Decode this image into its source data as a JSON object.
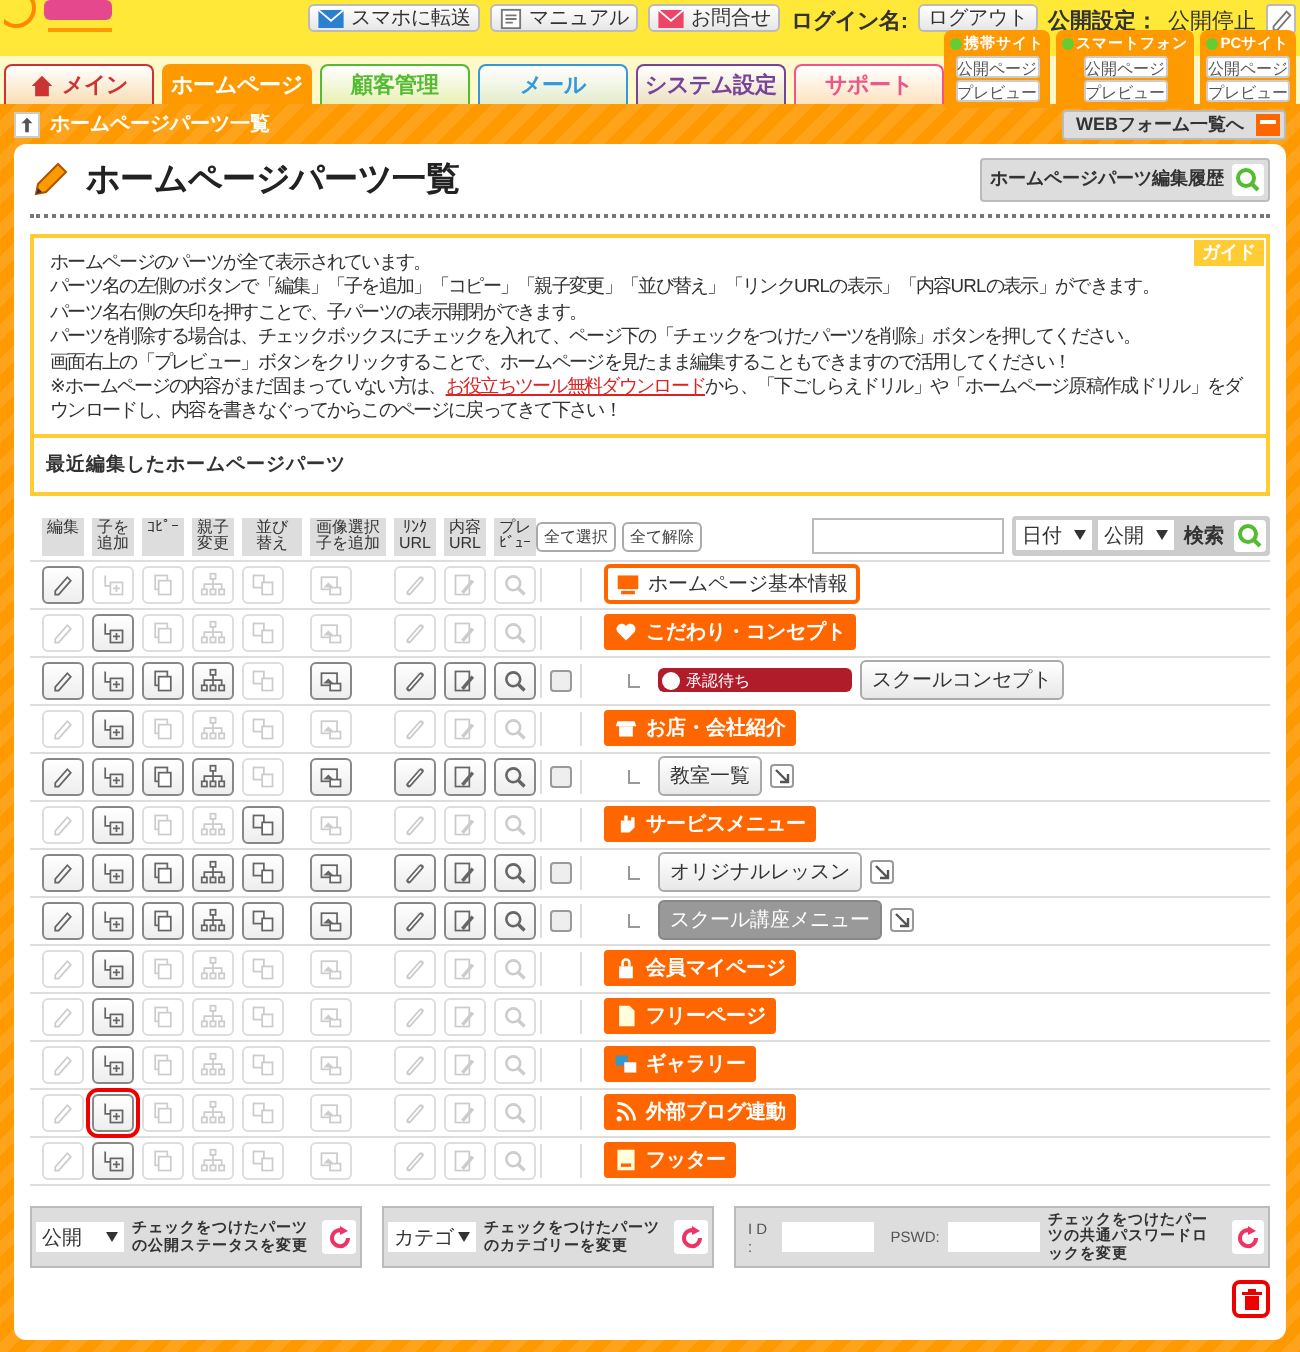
{
  "header": {
    "top_buttons": [
      "スマホに転送",
      "マニュアル",
      "お問合せ"
    ],
    "login_label": "ログイン名:",
    "logout": "ログアウト",
    "publish_label": "公開設定：",
    "publish_value": "公開停止"
  },
  "sites": [
    {
      "title": "携帯サイト",
      "buttons": [
        "公開ページ",
        "プレビュー"
      ]
    },
    {
      "title": "スマートフォン",
      "buttons": [
        "公開ページ",
        "プレビュー"
      ]
    },
    {
      "title": "PCサイト",
      "buttons": [
        "公開ページ",
        "プレビュー"
      ]
    }
  ],
  "tabs": [
    {
      "label": "メイン",
      "color": "#cc3333",
      "selected": false
    },
    {
      "label": "ホームページ",
      "color": "#ff9900",
      "selected": true
    },
    {
      "label": "顧客管理",
      "color": "#55bb33",
      "selected": false
    },
    {
      "label": "メール",
      "color": "#3399dd",
      "selected": false
    },
    {
      "label": "システム設定",
      "color": "#774499",
      "selected": false
    },
    {
      "label": "サポート",
      "color": "#ee5588",
      "selected": false
    }
  ],
  "breadcrumb": "ホームページパーツ一覧",
  "web_form_button": "WEBフォーム一覧へ",
  "page_title": "ホームページパーツ一覧",
  "history_button": "ホームページパーツ編集履歴",
  "guide": {
    "badge": "ガイド",
    "lines": [
      {
        "text": "ホームページのパーツが全て表示されています。"
      },
      {
        "text": "パーツ名の左側のボタンで「編集」「子を追加」「コピー」「親子変更」「並び替え」「リンクURLの表示」「内容URLの表示」ができます。"
      },
      {
        "text": "パーツ名右側の矢印を押すことで、子パーツの表示開閉ができます。"
      },
      {
        "text": "パーツを削除する場合は、チェックボックスにチェックを入れて、ページ下の「チェックをつけたパーツを削除」ボタンを押してください。"
      },
      {
        "text": "画面右上の「プレビュー」ボタンをクリックすることで、ホームページを見たまま編集することもできますので活用してください！"
      },
      {
        "text": "※ホームページの内容がまだ固まっていない方は、",
        "link": "お役立ちツール無料ダウンロード",
        "after": "から、「下ごしらえドリル」や「ホームページ原稿作成ドリル」をダウンロードし、内容を書きなぐってからこのページに戻ってきて下さい！"
      }
    ],
    "recent": "最近編集したホームページパーツ"
  },
  "columns": [
    "編集",
    "子を追加",
    "ｺﾋﾟｰ",
    "親子変更",
    "並び替え",
    "画像選択子を追加",
    "ﾘﾝｸ URL",
    "内容 URL",
    "プレﾋﾞｭｰ"
  ],
  "select_all": "全て選択",
  "deselect_all": "全て解除",
  "search": {
    "sort": "日付",
    "status": "公開",
    "button": "検索"
  },
  "rows": [
    {
      "kind": "base",
      "name": "ホームページ基本情報",
      "enabled": [
        true,
        false,
        false,
        false,
        false,
        false,
        false,
        false,
        false
      ],
      "marked": false
    },
    {
      "kind": "category",
      "name": "こだわり・コンセプト",
      "enabled": [
        false,
        true,
        false,
        false,
        false,
        false,
        false,
        false,
        false
      ],
      "marked": false
    },
    {
      "kind": "child",
      "name": "スクールコンセプト",
      "status": "承認待ち",
      "checked": false,
      "expand": false,
      "dimmed": false,
      "enabled": [
        true,
        true,
        true,
        true,
        false,
        true,
        true,
        true,
        true
      ],
      "marked": false
    },
    {
      "kind": "category",
      "name": "お店・会社紹介",
      "enabled": [
        false,
        true,
        false,
        false,
        false,
        false,
        false,
        false,
        false
      ],
      "marked": false
    },
    {
      "kind": "child",
      "name": "教室一覧",
      "checked": false,
      "expand": true,
      "dimmed": false,
      "enabled": [
        true,
        true,
        true,
        true,
        false,
        true,
        true,
        true,
        true
      ],
      "marked": false
    },
    {
      "kind": "category",
      "name": "サービスメニュー",
      "enabled": [
        false,
        true,
        false,
        false,
        true,
        false,
        false,
        false,
        false
      ],
      "marked": false
    },
    {
      "kind": "child",
      "name": "オリジナルレッスン",
      "checked": false,
      "expand": true,
      "dimmed": false,
      "enabled": [
        true,
        true,
        true,
        true,
        true,
        true,
        true,
        true,
        true
      ],
      "marked": false
    },
    {
      "kind": "child",
      "name": "スクール講座メニュー",
      "checked": false,
      "expand": true,
      "dimmed": true,
      "enabled": [
        true,
        true,
        true,
        true,
        true,
        true,
        true,
        true,
        true
      ],
      "marked": false
    },
    {
      "kind": "category",
      "name": "会員マイページ",
      "enabled": [
        false,
        true,
        false,
        false,
        false,
        false,
        false,
        false,
        false
      ],
      "marked": false
    },
    {
      "kind": "category",
      "name": "フリーページ",
      "enabled": [
        false,
        true,
        false,
        false,
        false,
        false,
        false,
        false,
        false
      ],
      "marked": false
    },
    {
      "kind": "category",
      "name": "ギャラリー",
      "enabled": [
        false,
        true,
        false,
        false,
        false,
        false,
        false,
        false,
        false
      ],
      "marked": false
    },
    {
      "kind": "category",
      "name": "外部ブログ連動",
      "enabled": [
        false,
        true,
        false,
        false,
        false,
        false,
        false,
        false,
        false
      ],
      "marked": true
    },
    {
      "kind": "category",
      "name": "フッター",
      "enabled": [
        false,
        true,
        false,
        false,
        false,
        false,
        false,
        false,
        false
      ],
      "marked": false
    }
  ],
  "bulk": [
    {
      "kind": "select",
      "value": "公開",
      "text": "チェックをつけたパーツの公開ステータスを変更"
    },
    {
      "kind": "select",
      "value": "カテゴ",
      "text": "チェックをつけたパーツのカテゴリーを変更"
    },
    {
      "kind": "password",
      "id_label": "I D :",
      "pswd_label": "PSWD:",
      "text": "チェックをつけたパーツの共通パスワードロックを変更"
    }
  ]
}
